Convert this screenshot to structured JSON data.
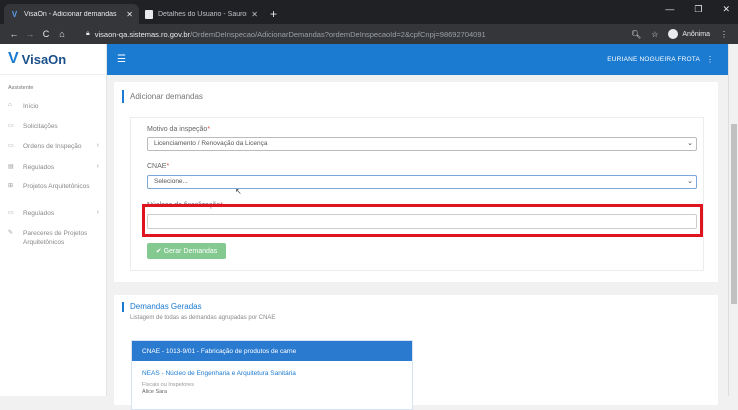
{
  "browser": {
    "tabs": [
      {
        "title": "VisaOn - Adicionar demandas",
        "icon": "visaon-tab-icon"
      },
      {
        "title": "Detalhes do Usuario - Sauron.Ge",
        "icon": "page-tab-icon"
      }
    ],
    "url_domain": "visaon-qa.sistemas.ro.gov.br",
    "url_path": "/OrdemDeInspecao/AdicionarDemandas?ordemDeInspecaoId=2&cpfCnpj=98692704091",
    "profile": "Anônima"
  },
  "app": {
    "logo_v": "V",
    "logo_text": "VisaOn",
    "user_name": "EURIANE NOGUEIRA FROTA"
  },
  "sidebar": {
    "section": "Assistente",
    "items": [
      {
        "label": "Início",
        "icon": "home-icon",
        "chevron": false
      },
      {
        "label": "Solicitações",
        "icon": "document-icon",
        "chevron": false
      },
      {
        "label": "Ordens de Inspeção",
        "icon": "document-icon",
        "chevron": true
      },
      {
        "label": "Regulados",
        "icon": "building-icon",
        "chevron": true
      },
      {
        "label": "Projetos Arquitetônicos",
        "icon": "blueprint-icon",
        "chevron": false
      },
      {
        "label": "Regulados",
        "icon": "document-icon",
        "chevron": true
      },
      {
        "label": "Pareceres de Projetos Arquitetônicos",
        "icon": "pencil-icon",
        "chevron": false
      }
    ]
  },
  "form": {
    "title": "Adicionar demandas",
    "motivo_label": "Motivo da inspeção",
    "motivo_value": "Licenciamento / Renovação da Licença",
    "cnae_label": "CNAE",
    "cnae_value": "Selecione...",
    "nucleos_label": "Núcleos de fiscalização",
    "required_mark": "*",
    "submit_label": "Gerar Demandas"
  },
  "demandas": {
    "title": "Demandas Geradas",
    "subtitle": "Listagem de todas as demandas agrupadas por CNAE",
    "cnae_heading": "CNAE - 1013-9/01 - Fabricação de produtos de carne",
    "nucleo": "NEAS - Núcleo de Engenharia e Arquitetura Sanitária",
    "fiscais_label": "Fiscais ou Inspetores",
    "fiscal_name": "Alice Sara"
  },
  "colors": {
    "primary": "#1b7bd0",
    "highlight": "#e0141e",
    "button": "#83c990"
  }
}
